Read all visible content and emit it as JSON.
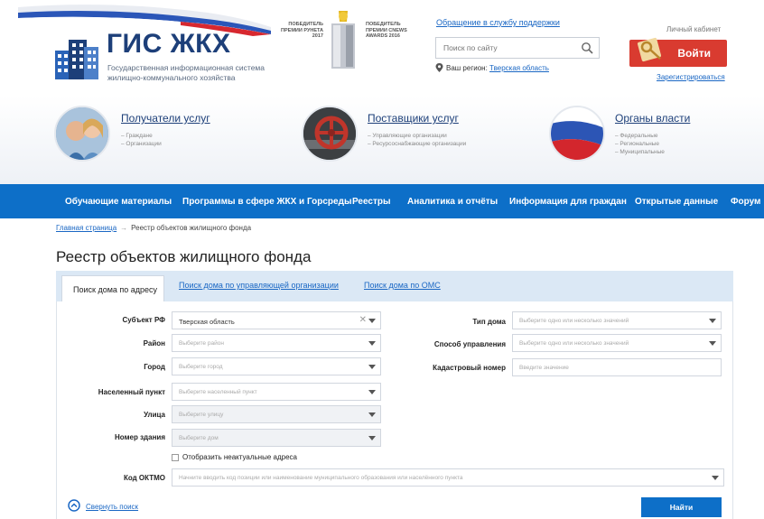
{
  "header": {
    "logo_title": "ГИС ЖКХ",
    "logo_subtitle": "Государственная информационная система жилищно-коммунального хозяйства",
    "award1": "ПОБЕДИТЕЛЬ ПРЕМИИ РУНЕТА 2017",
    "award2": "ПОБЕДИТЕЛЬ ПРЕМИИ CNEWS AWARDS 2016",
    "support_link": "Обращение в службу поддержки",
    "search_placeholder": "Поиск по сайту",
    "region_label": "Ваш регион:",
    "region_value": "Тверская область",
    "cabinet_label": "Личный кабинет",
    "login_label": "Войти",
    "register_link": "Зарегистрироваться"
  },
  "categories": [
    {
      "title": "Получатели услуг",
      "subs": [
        "– Граждане",
        "– Организации"
      ]
    },
    {
      "title": "Поставщики услуг",
      "subs": [
        "– Управляющие организации",
        "– Ресурсоснабжающие организации"
      ]
    },
    {
      "title": "Органы власти",
      "subs": [
        "– Федеральные",
        "– Региональные",
        "– Муниципальные"
      ]
    }
  ],
  "nav": [
    "Обучающие материалы",
    "Программы в сфере ЖКХ и Горсреды",
    "Реестры",
    "Аналитика и отчёты",
    "Информация для граждан",
    "Открытые данные",
    "Форум"
  ],
  "breadcrumb": {
    "home": "Главная страница",
    "separator": "→",
    "current": "Реестр объектов жилищного фонда"
  },
  "page_title": "Реестр объектов жилищного фонда",
  "tabs": {
    "active": "Поиск дома по адресу",
    "tab2": "Поиск дома по управляющей организации",
    "tab3": "Поиск дома по ОМС"
  },
  "form": {
    "subject_label": "Субъект РФ",
    "subject_value": "Тверская область",
    "district_label": "Район",
    "district_placeholder": "Выберите район",
    "city_label": "Город",
    "city_placeholder": "Выберите город",
    "settlement_label": "Населенный пункт",
    "settlement_placeholder": "Выберите населенный пункт",
    "street_label": "Улица",
    "street_placeholder": "Выберите улицу",
    "building_label": "Номер здания",
    "building_placeholder": "Выберите дом",
    "house_type_label": "Тип дома",
    "house_type_placeholder": "Выберите одно или несколько значений",
    "mgmt_label": "Способ управления",
    "mgmt_placeholder": "Выберите одно или несколько значений",
    "cadastral_label": "Кадастровый номер",
    "cadastral_placeholder": "Введите значение",
    "irrelevant_label": "Отобразить неактуальные адреса",
    "oktmo_label": "Код ОКТМО",
    "oktmo_placeholder": "Начните вводить код позиции или наименование муниципального образования или населённого пункта",
    "collapse_label": "Свернуть поиск",
    "find_label": "Найти"
  },
  "colors": {
    "brand_blue": "#0d6fc8",
    "login_red": "#d93b30",
    "link": "#1a67c4"
  }
}
